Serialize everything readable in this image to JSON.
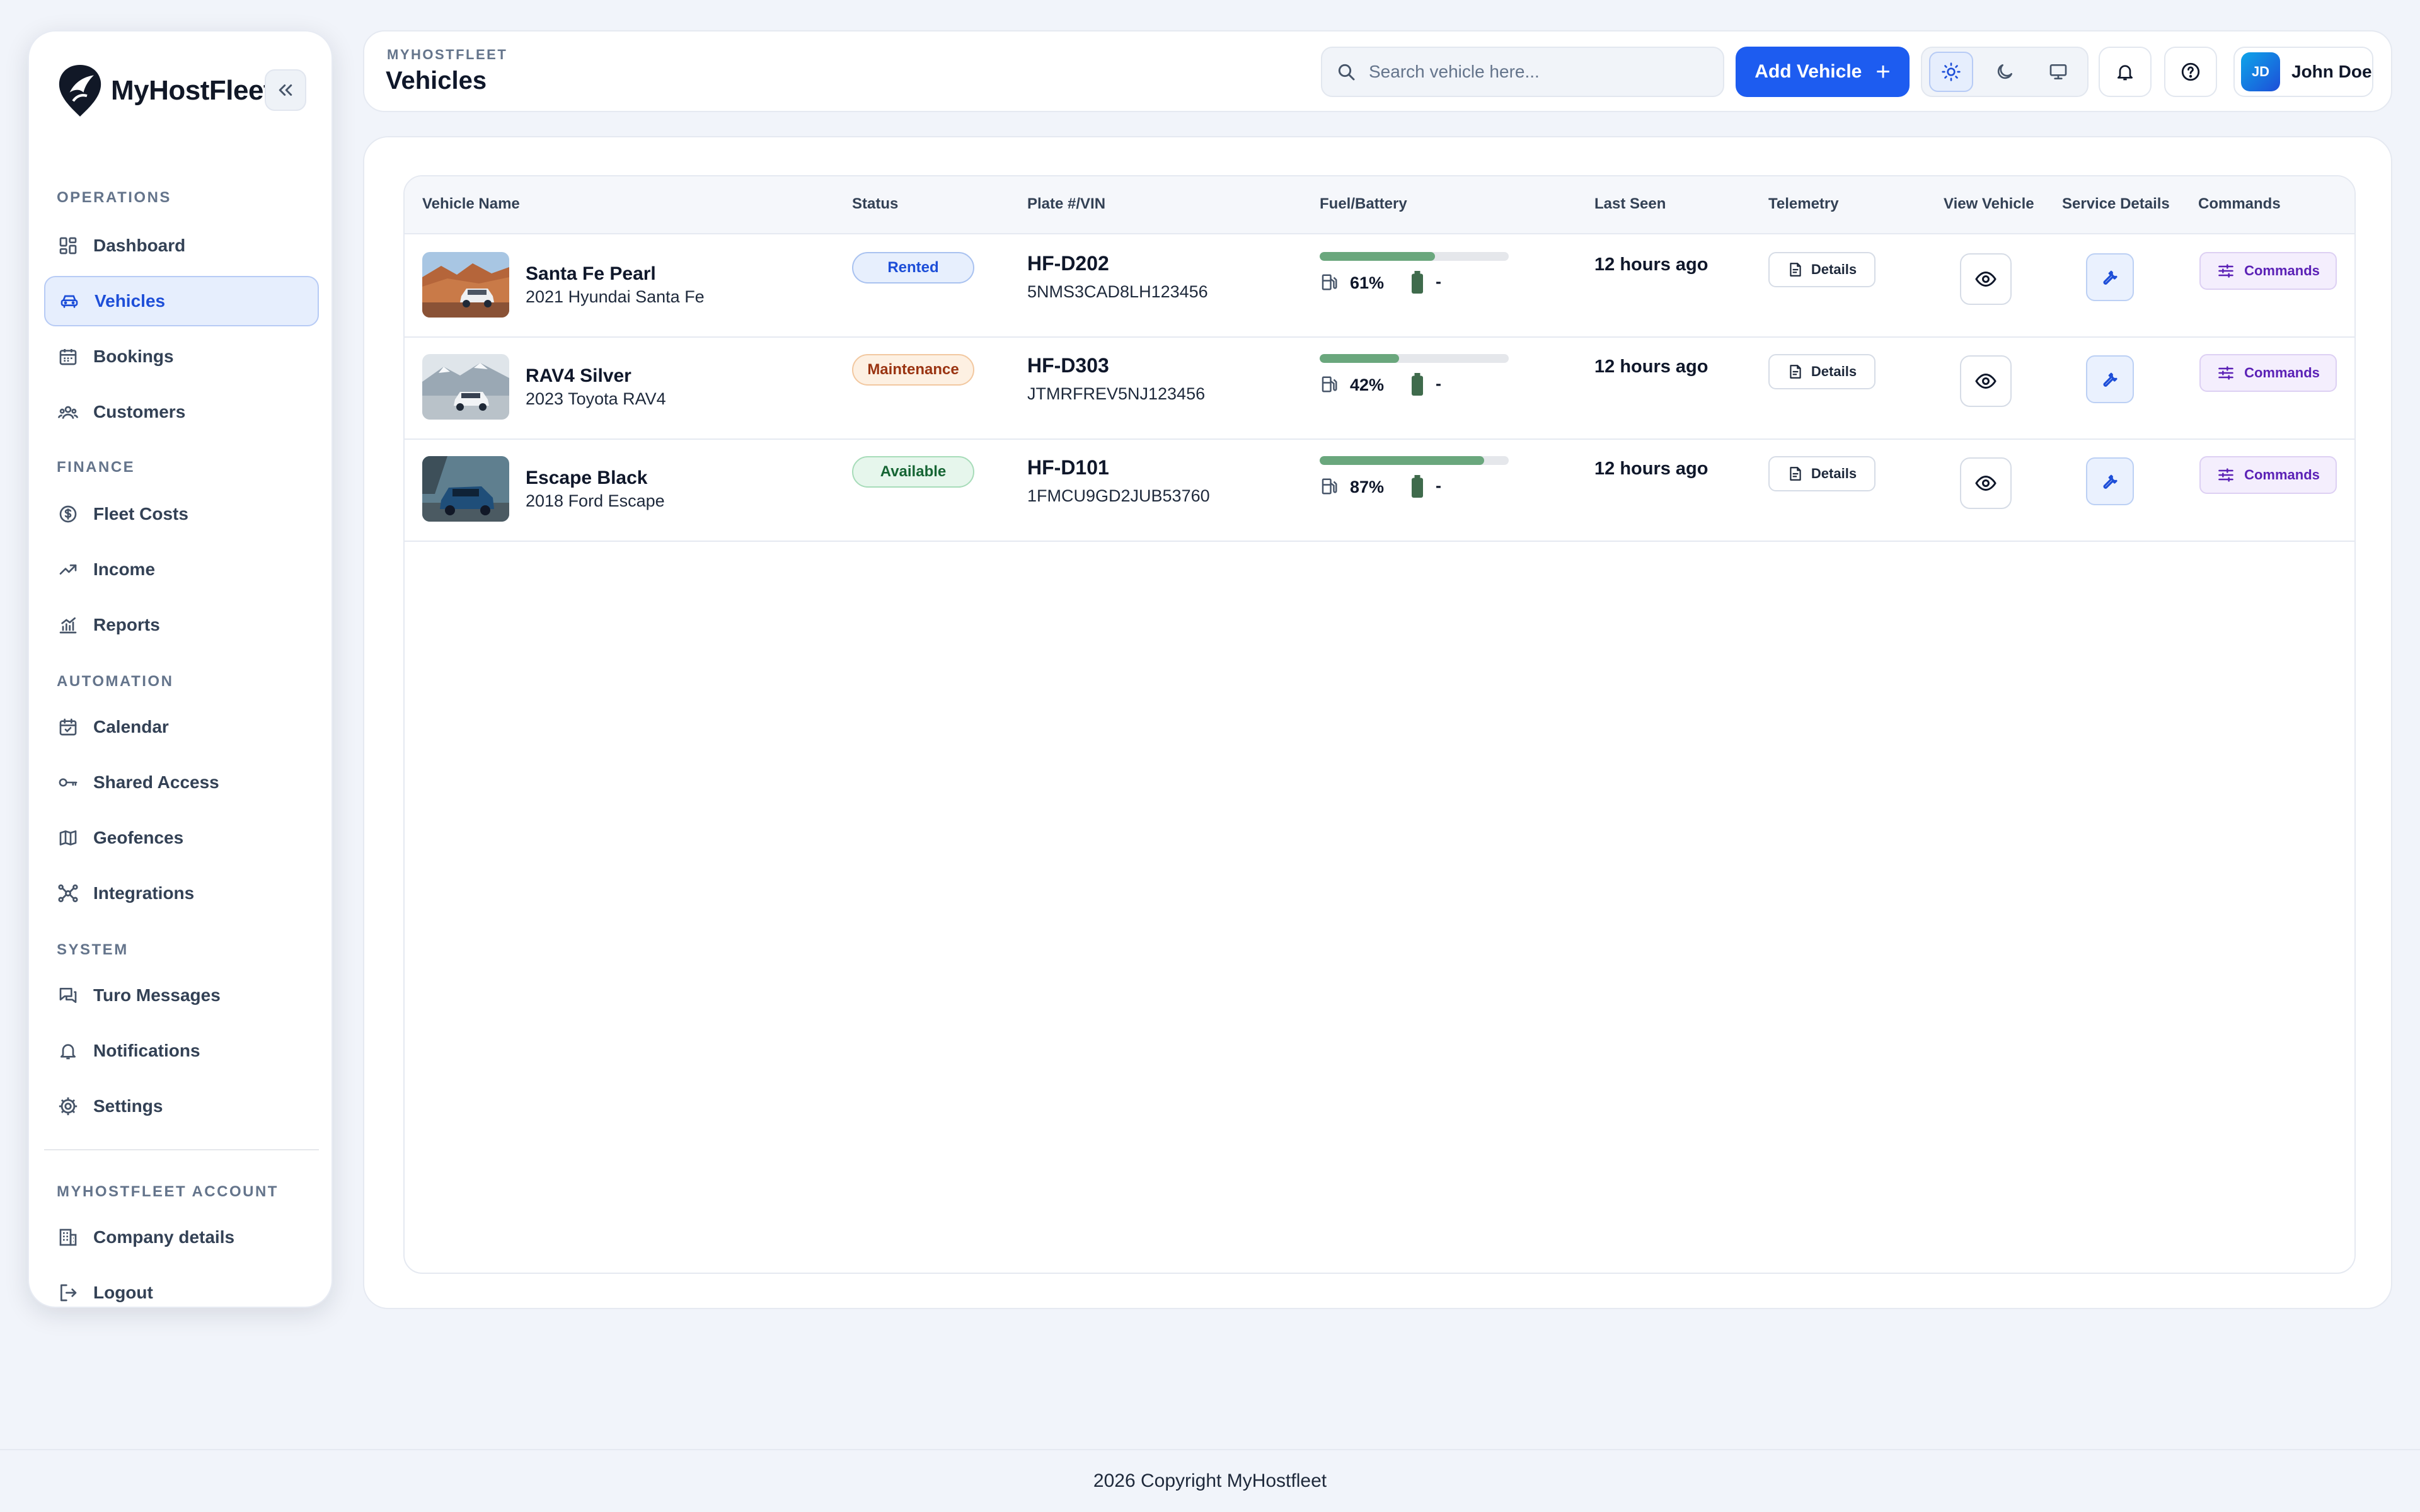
{
  "app": {
    "name": "MyHostFleet"
  },
  "sidebar": {
    "collapse_icon": "chevrons-left-icon",
    "sections": [
      {
        "label": "OPERATIONS",
        "items": [
          {
            "label": "Dashboard",
            "icon": "dashboard-icon"
          },
          {
            "label": "Vehicles",
            "icon": "car-icon",
            "active": true
          },
          {
            "label": "Bookings",
            "icon": "calendar-icon"
          },
          {
            "label": "Customers",
            "icon": "users-icon"
          }
        ]
      },
      {
        "label": "FINANCE",
        "items": [
          {
            "label": "Fleet Costs",
            "icon": "dollar-icon"
          },
          {
            "label": "Income",
            "icon": "trending-up-icon"
          },
          {
            "label": "Reports",
            "icon": "bar-chart-icon"
          }
        ]
      },
      {
        "label": "AUTOMATION",
        "items": [
          {
            "label": "Calendar",
            "icon": "calendar-check-icon"
          },
          {
            "label": "Shared Access",
            "icon": "key-icon"
          },
          {
            "label": "Geofences",
            "icon": "map-icon"
          },
          {
            "label": "Integrations",
            "icon": "network-icon"
          }
        ]
      },
      {
        "label": "SYSTEM",
        "items": [
          {
            "label": "Turo Messages",
            "icon": "messages-icon"
          },
          {
            "label": "Notifications",
            "icon": "bell-icon"
          },
          {
            "label": "Settings",
            "icon": "gear-icon"
          }
        ]
      },
      {
        "label": "MYHOSTFLEET ACCOUNT",
        "items": [
          {
            "label": "Company details",
            "icon": "building-icon"
          },
          {
            "label": "Logout",
            "icon": "logout-icon"
          }
        ]
      }
    ]
  },
  "header": {
    "breadcrumb": "MYHOSTFLEET",
    "title": "Vehicles",
    "search_placeholder": "Search vehicle here...",
    "add_label": "Add Vehicle",
    "add_plus": "+",
    "user_initials": "JD",
    "user_name": "John Doe"
  },
  "table": {
    "columns": [
      "Vehicle Name",
      "Status",
      "Plate #/VIN",
      "Fuel/Battery",
      "Last Seen",
      "Telemetry",
      "View Vehicle",
      "Service Details",
      "Commands"
    ],
    "rows": [
      {
        "name": "Santa Fe Pearl",
        "model": "2021 Hyundai Santa Fe",
        "status": "Rented",
        "status_color": "#1d4ed8",
        "plate": "HF-D202",
        "vin": "5NMS3CAD8LH123456",
        "fuel": 61,
        "fuel_label": "61%",
        "battery": "-",
        "last_seen": "12 hours ago",
        "telemetry_label": "Details",
        "commands_label": "Commands"
      },
      {
        "name": "RAV4 Silver",
        "model": "2023 Toyota RAV4",
        "status": "Maintenance",
        "status_color": "#9a3412",
        "plate": "HF-D303",
        "vin": "JTMRFREV5NJ123456",
        "fuel": 42,
        "fuel_label": "42%",
        "battery": "-",
        "last_seen": "12 hours ago",
        "telemetry_label": "Details",
        "commands_label": "Commands"
      },
      {
        "name": "Escape Black",
        "model": "2018 Ford Escape",
        "status": "Available",
        "status_color": "#166534",
        "plate": "HF-D101",
        "vin": "1FMCU9GD2JUB53760",
        "fuel": 87,
        "fuel_label": "87%",
        "battery": "-",
        "last_seen": "12 hours ago",
        "telemetry_label": "Details",
        "commands_label": "Commands"
      }
    ]
  },
  "footer": {
    "text": "2026 Copyright MyHostfleet"
  },
  "colors": {
    "accent": "#1d5cf0",
    "fuel_bar": "#6aa77d"
  }
}
